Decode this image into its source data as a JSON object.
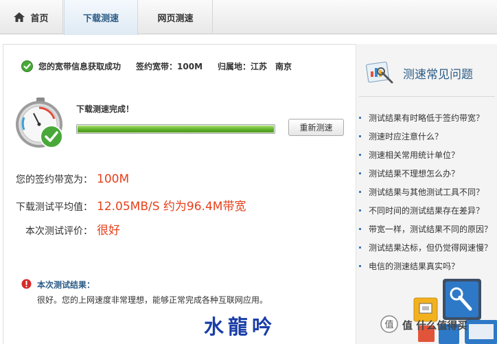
{
  "tabs": {
    "home": "首页",
    "download_test": "下载测速",
    "web_test": "网页测速"
  },
  "info": {
    "status": "您的宽带信息获取成功",
    "contract_bandwidth": "签约宽带：100M",
    "location": "归属地：江苏　南京"
  },
  "test": {
    "done_text": "下载测速完成！",
    "progress": 1.0,
    "retest_label": "重新测速"
  },
  "results": {
    "contract_label": "您的签约带宽为：",
    "contract_value": "100M",
    "avg_label": "下载测试平均值：",
    "avg_value": "12.05MB/S 约为96.4M带宽",
    "rating_label": "本次测试评价：",
    "rating_value": "很好"
  },
  "note": {
    "title": "本次测试结果：",
    "body": "很好。您的上网速度非常理想，能够正常完成各种互联网应用。"
  },
  "faq": {
    "title": "测速常见问题",
    "items": [
      "测试结果有时略低于签约带宽？",
      "测速时应注意什么？",
      "测速相关常用统计单位？",
      "测试结果不理想怎么办？",
      "测试结果与其他测试工具不同？",
      "不同时间的测试结果存在差异？",
      "带宽一样，测试结果不同的原因？",
      "测试结果达标，但仍觉得网速慢？",
      "电信的测速结果真实吗？"
    ]
  },
  "watermark": {
    "text": "水龍吟",
    "site": "值 什么值得买"
  },
  "colors": {
    "accent_blue": "#2b5b86",
    "value_red": "#e6401b",
    "success_green": "#5fb02a"
  }
}
